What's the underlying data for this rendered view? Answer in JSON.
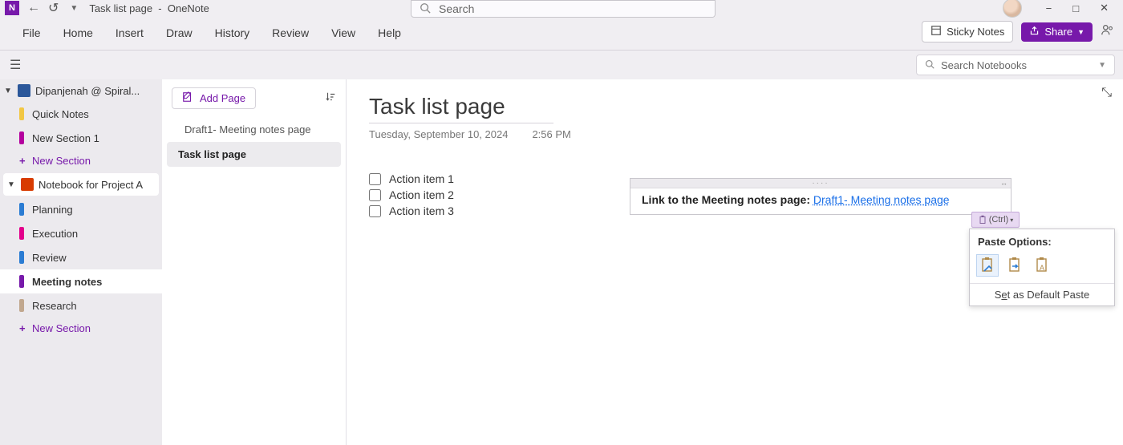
{
  "app": {
    "name_short": "N",
    "window_title": "Task list page  -  OneNote"
  },
  "titlebar_search_placeholder": "Search",
  "ribbon": {
    "tabs": [
      "File",
      "Home",
      "Insert",
      "Draw",
      "History",
      "Review",
      "View",
      "Help"
    ],
    "sticky_notes": "Sticky Notes",
    "share": "Share"
  },
  "notebook_panel": {
    "search_placeholder": "Search Notebooks",
    "notebooks": [
      {
        "name": "Dipanjenah @ Spiral...",
        "color": "#2b579a",
        "sections": [
          {
            "name": "Quick Notes",
            "color": "#f2c744"
          },
          {
            "name": "New Section 1",
            "color": "#b4009e"
          }
        ]
      },
      {
        "name": "Notebook for Project A",
        "color": "#d83b01",
        "sections": [
          {
            "name": "Planning",
            "color": "#2b7cd3"
          },
          {
            "name": "Execution",
            "color": "#e3008c"
          },
          {
            "name": "Review",
            "color": "#2b7cd3"
          },
          {
            "name": "Meeting notes",
            "color": "#7719aa",
            "active": true
          },
          {
            "name": "Research",
            "color": "#c1a78e"
          }
        ]
      }
    ],
    "add_section": "New Section"
  },
  "pages_panel": {
    "add_page": "Add Page",
    "pages": [
      {
        "title": "Draft1- Meeting notes page"
      },
      {
        "title": "Task list page",
        "active": true
      }
    ]
  },
  "canvas": {
    "title": "Task list page",
    "date": "Tuesday, September 10, 2024",
    "time": "2:56 PM",
    "tasks": [
      "Action item 1",
      "Action item 2",
      "Action item 3"
    ],
    "link_note": {
      "label": "Link to the Meeting notes page: ",
      "link_text": "Draft1- Meeting notes page"
    }
  },
  "paste_ctrl": "(Ctrl)",
  "paste_options": {
    "header": "Paste Options:",
    "set_default_pre": "S",
    "set_default_u": "e",
    "set_default_post": "t as Default Paste"
  }
}
